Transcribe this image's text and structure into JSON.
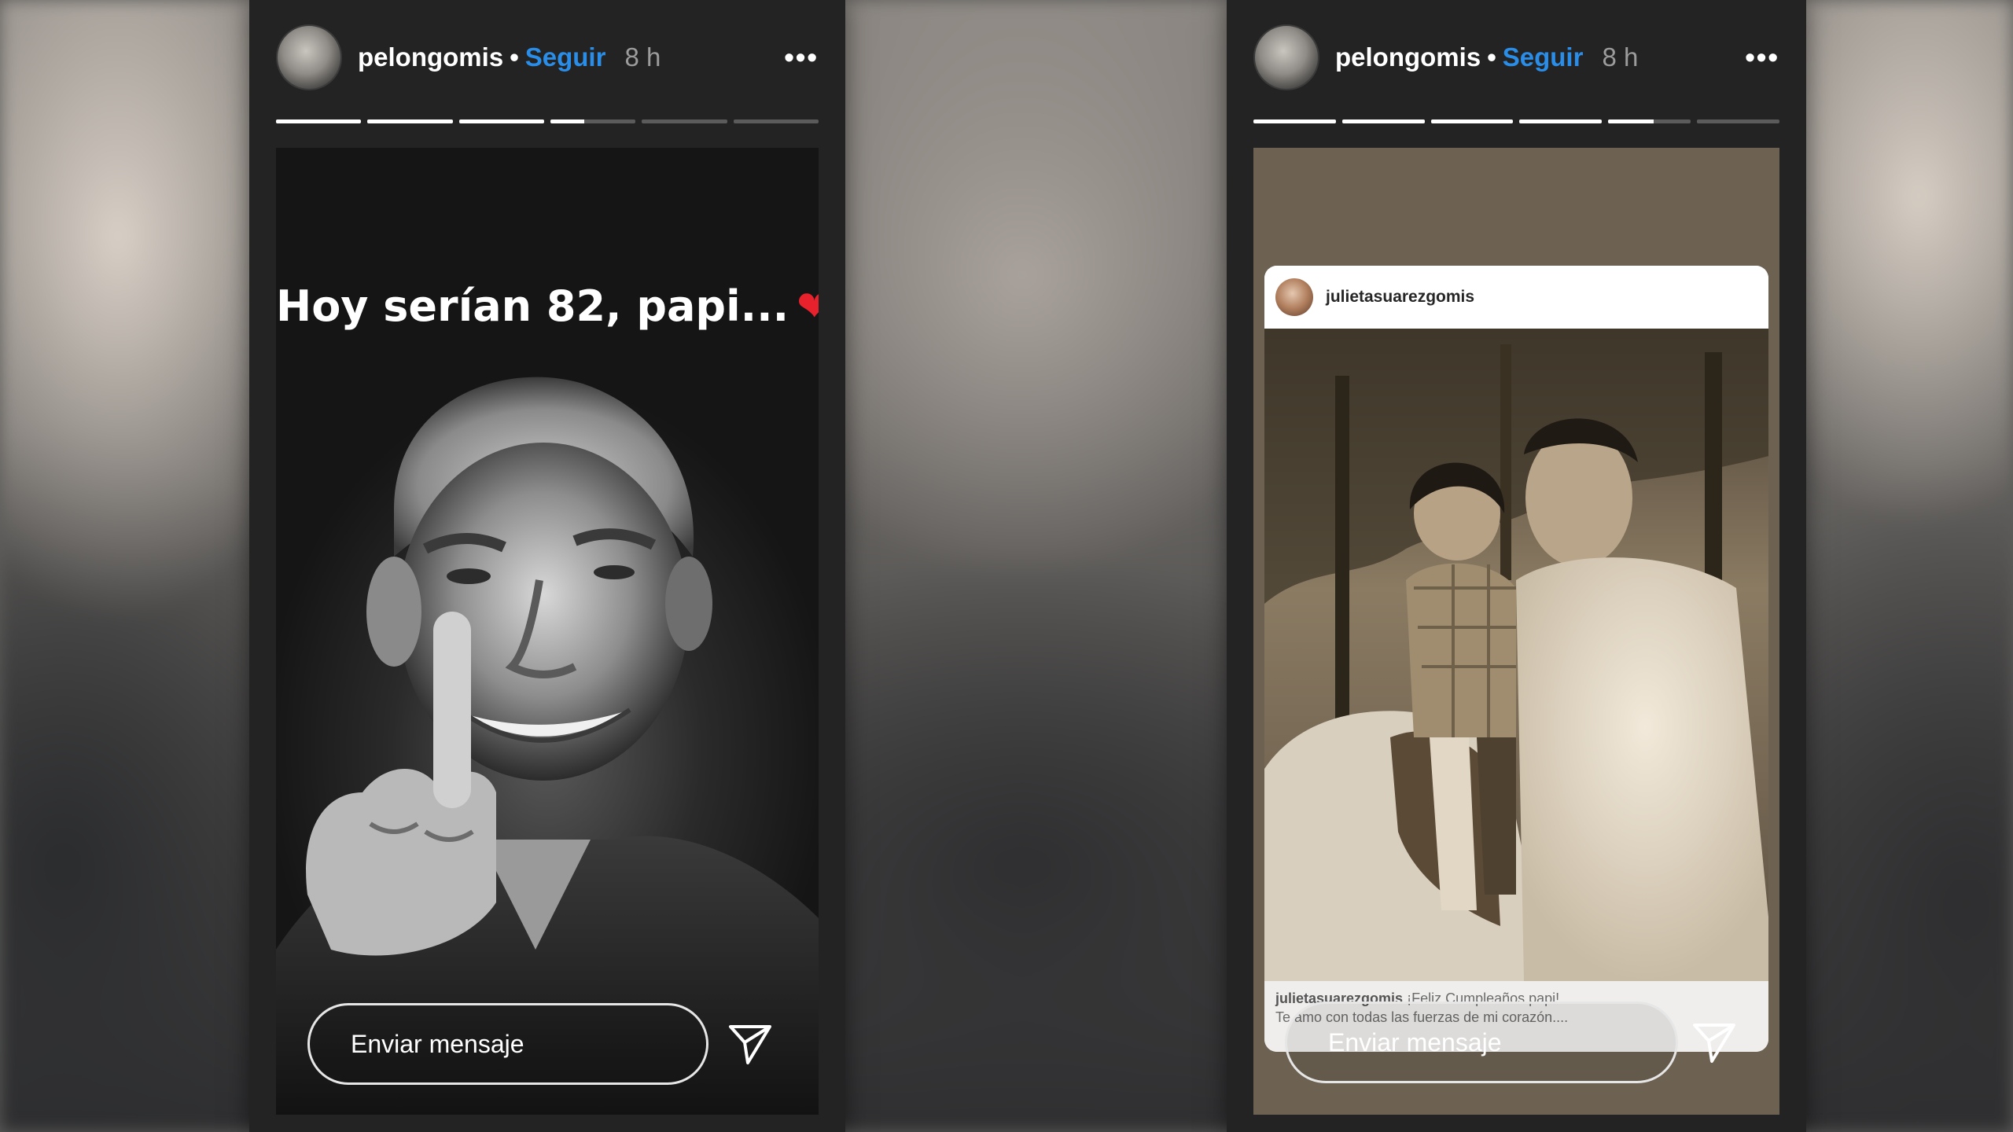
{
  "stories": [
    {
      "username": "pelongomis",
      "separator": "•",
      "follow_label": "Seguir",
      "time": "8 h",
      "more_label": "•••",
      "progress": [
        1,
        1,
        1,
        0.4,
        0,
        0
      ],
      "caption": "Hoy serían 82, papi...",
      "caption_emoji": "❤",
      "message_placeholder": "Enviar mensaje"
    },
    {
      "username": "pelongomis",
      "separator": "•",
      "follow_label": "Seguir",
      "time": "8 h",
      "more_label": "•••",
      "progress": [
        1,
        1,
        1,
        1,
        0.55,
        0
      ],
      "embedded_post": {
        "username": "julietasuarezgomis",
        "caption_user": "julietasuarezgomis",
        "caption_text": "¡Feliz Cumpleaños papi!",
        "caption_line2": "Te amo con todas las fuerzas de mi corazón...."
      },
      "message_placeholder": "Enviar mensaje"
    }
  ],
  "colors": {
    "follow_blue": "#2a8ee8",
    "story_bg": "#232324",
    "heart_red": "#e8222c"
  }
}
